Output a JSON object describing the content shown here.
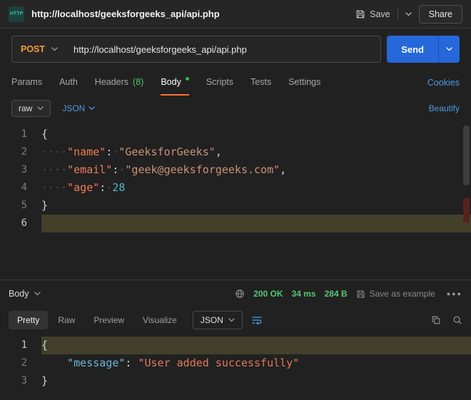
{
  "colors": {
    "accent_orange": "#ff6c37",
    "method_post": "#f79a3e",
    "link_blue": "#4c9ae2",
    "success_green": "#53c771",
    "send_blue": "#2667d9",
    "line_highlight": "#42402a"
  },
  "topbar": {
    "badge": "HTTP",
    "title": "http://localhost/geeksforgeeks_api/api.php",
    "save": "Save",
    "share": "Share"
  },
  "request": {
    "method": "POST",
    "url": "http://localhost/geeksforgeeks_api/api.php",
    "send": "Send"
  },
  "tabs": {
    "params": "Params",
    "auth": "Auth",
    "headers": "Headers",
    "headers_count": "(8)",
    "body": "Body",
    "scripts": "Scripts",
    "tests": "Tests",
    "settings": "Settings",
    "cookies": "Cookies"
  },
  "body_toolbar": {
    "format": "raw",
    "language": "JSON",
    "beautify": "Beautify"
  },
  "editor": {
    "lines": [
      {
        "num": "1",
        "open": "{"
      },
      {
        "num": "2",
        "ws": "····",
        "key": "\"name\"",
        "colon": ":",
        "sep": "·",
        "val": "\"GeeksforGeeks\"",
        "comma": ","
      },
      {
        "num": "3",
        "ws": "····",
        "key": "\"email\"",
        "colon": ":",
        "sep": "·",
        "val": "\"geek@geeksforgeeks.com\"",
        "comma": ","
      },
      {
        "num": "4",
        "ws": "····",
        "key": "\"age\"",
        "colon": ":",
        "sep": "·",
        "numval": "28"
      },
      {
        "num": "5",
        "close": "}"
      },
      {
        "num": "6"
      }
    ]
  },
  "response": {
    "body_label": "Body",
    "status": "200 OK",
    "time": "34 ms",
    "size": "284 B",
    "save_example": "Save as example",
    "tabs": {
      "pretty": "Pretty",
      "raw": "Raw",
      "preview": "Preview",
      "visualize": "Visualize"
    },
    "language": "JSON",
    "lines": [
      {
        "num": "1",
        "open": "{"
      },
      {
        "num": "2",
        "ws": "    ",
        "key": "\"message\"",
        "colon": ": ",
        "val": "\"User added successfully\""
      },
      {
        "num": "3",
        "close": "}"
      }
    ]
  }
}
